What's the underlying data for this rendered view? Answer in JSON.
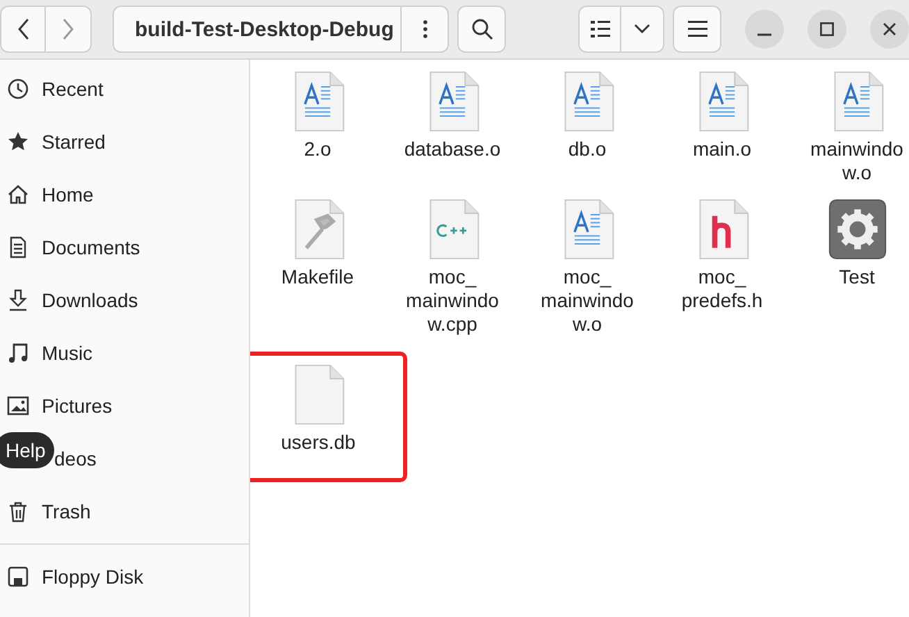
{
  "header": {
    "path": "build-Test-Desktop-Debug"
  },
  "sidebar": {
    "items": [
      {
        "label": "Recent",
        "kind": "clock"
      },
      {
        "label": "Starred",
        "kind": "star"
      },
      {
        "label": "Home",
        "kind": "home"
      },
      {
        "label": "Documents",
        "kind": "doc"
      },
      {
        "label": "Downloads",
        "kind": "download"
      },
      {
        "label": "Music",
        "kind": "music"
      },
      {
        "label": "Pictures",
        "kind": "picture"
      },
      {
        "label": "deos",
        "kind": "covered"
      },
      {
        "label": "Trash",
        "kind": "trash"
      }
    ],
    "devices": [
      {
        "label": "Floppy Disk",
        "kind": "disk"
      }
    ]
  },
  "tooltip": "Help",
  "files": [
    {
      "name": "2.o",
      "kind": "text",
      "highlighted": false
    },
    {
      "name": "database.o",
      "kind": "text",
      "highlighted": false
    },
    {
      "name": "db.o",
      "kind": "text",
      "highlighted": false
    },
    {
      "name": "main.o",
      "kind": "text",
      "highlighted": false
    },
    {
      "name": "mainwindo w.o",
      "kind": "text",
      "highlighted": false
    },
    {
      "name": "Makefile",
      "kind": "make",
      "highlighted": false
    },
    {
      "name": "moc_ mainwindo w.cpp",
      "kind": "cpp",
      "highlighted": false
    },
    {
      "name": "moc_ mainwindo w.o",
      "kind": "text",
      "highlighted": false
    },
    {
      "name": "moc_ predefs.h",
      "kind": "header",
      "highlighted": false
    },
    {
      "name": "Test",
      "kind": "exec",
      "highlighted": false
    },
    {
      "name": "users.db",
      "kind": "blank",
      "highlighted": true
    }
  ]
}
